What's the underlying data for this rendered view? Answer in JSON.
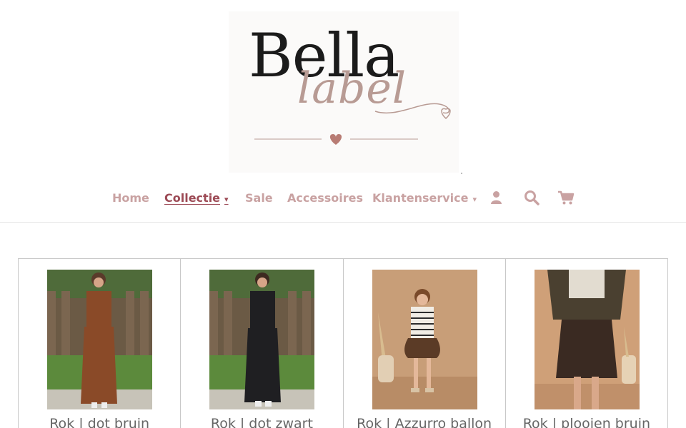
{
  "logo": {
    "line1": "Bella",
    "line2": "label"
  },
  "nav": {
    "items": [
      {
        "label": "Home"
      },
      {
        "label": "Collectie",
        "caret": "▾"
      },
      {
        "label": "Sale"
      },
      {
        "label": "Accessoires"
      },
      {
        "label": "Klantenservice",
        "caret": "▾"
      }
    ],
    "icons": [
      "account-icon",
      "search-icon",
      "cart-icon"
    ]
  },
  "products": [
    {
      "title": "Rok | dot bruin"
    },
    {
      "title": "Rok | dot zwart"
    },
    {
      "title": "Rok | Azzurro ballon"
    },
    {
      "title": "Rok | plooien bruin"
    }
  ],
  "colors": {
    "nav_link": "#c9a2a2",
    "nav_active": "#9c4a55",
    "logo_accent": "#b89b94",
    "heart": "#b87c74"
  }
}
